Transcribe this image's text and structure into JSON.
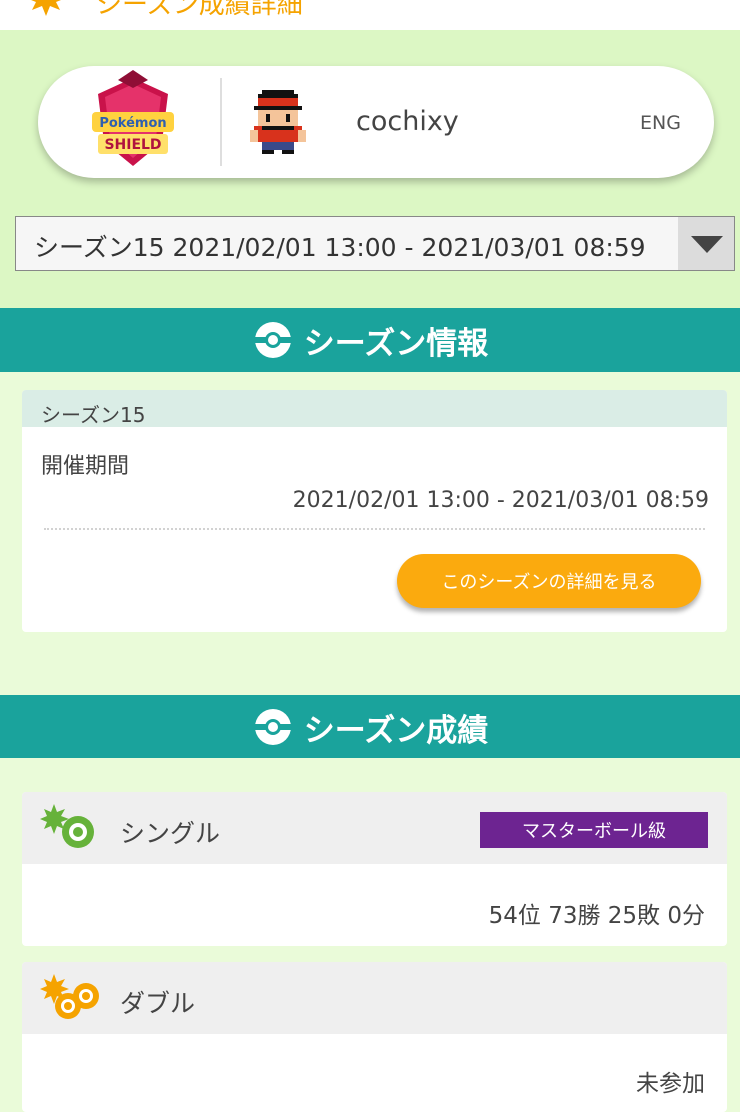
{
  "topbar": {
    "title_fragment": "シーズン成績詳細",
    "icon": "sun-icon"
  },
  "profile": {
    "game_logo": "Pokemon SHIELD",
    "logo_line1": "Pokémon",
    "logo_line2": "SHIELD",
    "username": "cochixy",
    "language": "ENG",
    "avatar_icon": "trainer-avatar-icon"
  },
  "season_select": {
    "value": "シーズン15 2021/02/01 13:00 - 2021/03/01 08:59"
  },
  "season_info": {
    "title": "シーズン情報",
    "season_name": "シーズン15",
    "period_label": "開催期間",
    "period_value": "2021/02/01 13:00 - 2021/03/01 08:59",
    "detail_button": "このシーズンの詳細を見る"
  },
  "season_results": {
    "title": "シーズン成績",
    "single": {
      "label": "シングル",
      "rank_badge": "マスターボール級",
      "record": "54位 73勝 25敗 0分"
    },
    "double": {
      "label": "ダブル",
      "record": "未参加"
    }
  },
  "colors": {
    "teal": "#1aa39c",
    "orange": "#fbaa0e",
    "purple": "#6d2491",
    "light_green": "#dcf7c4"
  }
}
